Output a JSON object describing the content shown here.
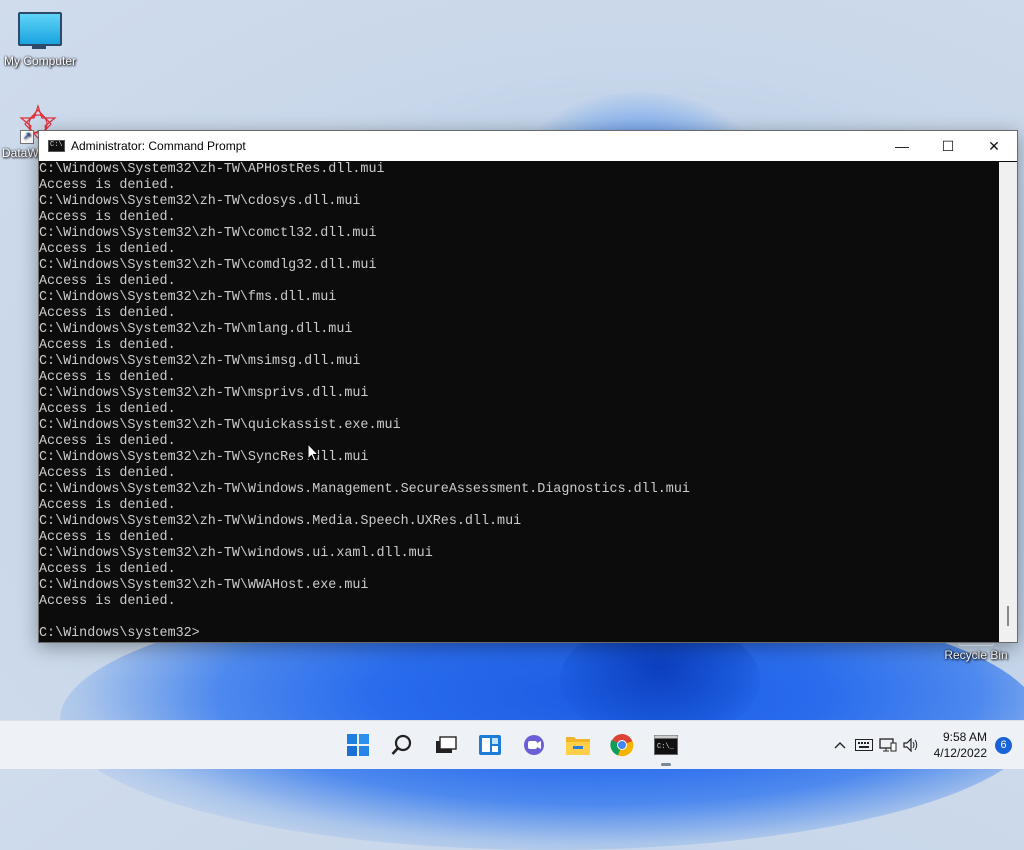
{
  "desktop": {
    "icons": [
      {
        "label": "My Computer"
      },
      {
        "label": "DataW"
      },
      {
        "label": "Recycle Bin"
      }
    ]
  },
  "window": {
    "title": "Administrator: Command Prompt",
    "icon_text": "C:\\",
    "buttons": {
      "minimize": "—",
      "maximize": "☐",
      "close": "✕"
    }
  },
  "console": {
    "lines": [
      "C:\\Windows\\System32\\zh-TW\\APHostRes.dll.mui",
      "Access is denied.",
      "C:\\Windows\\System32\\zh-TW\\cdosys.dll.mui",
      "Access is denied.",
      "C:\\Windows\\System32\\zh-TW\\comctl32.dll.mui",
      "Access is denied.",
      "C:\\Windows\\System32\\zh-TW\\comdlg32.dll.mui",
      "Access is denied.",
      "C:\\Windows\\System32\\zh-TW\\fms.dll.mui",
      "Access is denied.",
      "C:\\Windows\\System32\\zh-TW\\mlang.dll.mui",
      "Access is denied.",
      "C:\\Windows\\System32\\zh-TW\\msimsg.dll.mui",
      "Access is denied.",
      "C:\\Windows\\System32\\zh-TW\\msprivs.dll.mui",
      "Access is denied.",
      "C:\\Windows\\System32\\zh-TW\\quickassist.exe.mui",
      "Access is denied.",
      "C:\\Windows\\System32\\zh-TW\\SyncRes.dll.mui",
      "Access is denied.",
      "C:\\Windows\\System32\\zh-TW\\Windows.Management.SecureAssessment.Diagnostics.dll.mui",
      "Access is denied.",
      "C:\\Windows\\System32\\zh-TW\\Windows.Media.Speech.UXRes.dll.mui",
      "Access is denied.",
      "C:\\Windows\\System32\\zh-TW\\windows.ui.xaml.dll.mui",
      "Access is denied.",
      "C:\\Windows\\System32\\zh-TW\\WWAHost.exe.mui",
      "Access is denied.",
      "",
      "C:\\Windows\\system32>"
    ]
  },
  "taskbar": {
    "apps": [
      {
        "icon": "start-icon"
      },
      {
        "icon": "search-icon"
      },
      {
        "icon": "task-view-icon"
      },
      {
        "icon": "widgets-icon"
      },
      {
        "icon": "chat-icon"
      },
      {
        "icon": "file-explorer-icon"
      },
      {
        "icon": "chrome-icon"
      },
      {
        "icon": "command-prompt-icon",
        "active": true
      }
    ],
    "tray": {
      "chevron": "^",
      "time": "9:58 AM",
      "date": "4/12/2022",
      "notifications": "6"
    }
  },
  "colors": {
    "console_bg": "#0c0c0c",
    "console_fg": "#cccccc",
    "accent": "#1a63d6"
  }
}
